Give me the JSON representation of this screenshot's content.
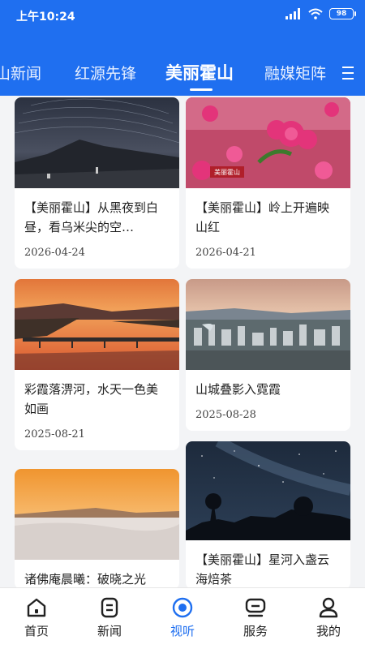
{
  "status": {
    "time": "上午10:24",
    "battery": "98"
  },
  "tabs": [
    {
      "label": "山新闻"
    },
    {
      "label": "红源先锋"
    },
    {
      "label": "美丽霍山"
    },
    {
      "label": "融媒矩阵"
    }
  ],
  "active_tab": "美丽霍山",
  "cards": [
    {
      "title": "【美丽霍山】从黑夜到白昼，看乌米尖的空…",
      "date": "2026-04-24",
      "image": "starry-mountain-night"
    },
    {
      "title": "【美丽霍山】岭上开遍映山红",
      "date": "2026-04-21",
      "image": "azalea-flowers"
    },
    {
      "title": "彩霞落淠河，水天一色美如画",
      "date": "2025-08-21",
      "image": "sunset-river-bridge"
    },
    {
      "title": "山城叠影入霓霞",
      "date": "2025-08-28",
      "image": "city-aerial-sunset"
    },
    {
      "title": "诸佛庵晨曦：破晓之光",
      "date": "",
      "image": "sunrise-sea-of-clouds"
    },
    {
      "title": "【美丽霍山】星河入盏云海焙茶",
      "date": "",
      "image": "milky-way-trees"
    }
  ],
  "image_overlay_text": {
    "card2": "美丽霍山"
  },
  "nav": [
    {
      "label": "首页",
      "icon": "home-icon"
    },
    {
      "label": "新闻",
      "icon": "news-icon"
    },
    {
      "label": "视听",
      "icon": "media-icon"
    },
    {
      "label": "服务",
      "icon": "service-icon"
    },
    {
      "label": "我的",
      "icon": "profile-icon"
    }
  ],
  "colors": {
    "brand": "#1f6ff0",
    "background": "#f3f4f6"
  }
}
